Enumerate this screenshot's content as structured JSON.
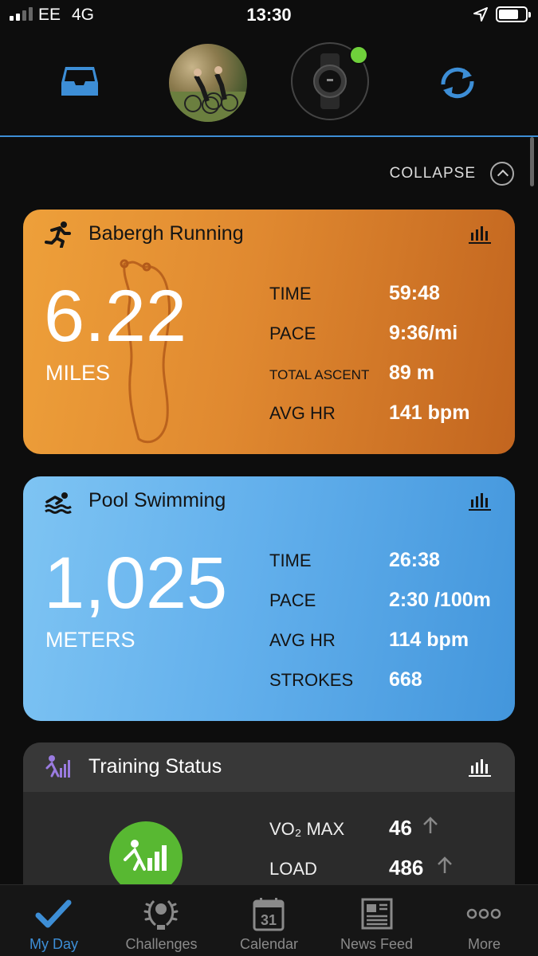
{
  "status_bar": {
    "carrier": "EE",
    "network": "4G",
    "time": "13:30"
  },
  "header": {
    "icons": [
      "inbox-icon",
      "profile-avatar",
      "device-watch",
      "sync-icon"
    ]
  },
  "collapse": {
    "label": "COLLAPSE"
  },
  "cards": {
    "running": {
      "title": "Babergh Running",
      "distance": "6.22",
      "unit": "MILES",
      "metrics": [
        {
          "label": "TIME",
          "value": "59:48"
        },
        {
          "label": "PACE",
          "value": "9:36/mi"
        },
        {
          "label": "TOTAL ASCENT",
          "value": "89 m"
        },
        {
          "label": "AVG HR",
          "value": "141 bpm"
        }
      ],
      "color": "#e08930"
    },
    "swimming": {
      "title": "Pool Swimming",
      "distance": "1,025",
      "unit": "METERS",
      "metrics": [
        {
          "label": "TIME",
          "value": "26:38"
        },
        {
          "label": "PACE",
          "value": "2:30 /100m"
        },
        {
          "label": "AVG HR",
          "value": "114 bpm"
        },
        {
          "label": "STROKES",
          "value": "668"
        }
      ],
      "color": "#63b0ec"
    },
    "training_status": {
      "title": "Training Status",
      "metrics": [
        {
          "label": "VO₂ MAX",
          "value": "46"
        },
        {
          "label": "LOAD",
          "value": "486"
        }
      ],
      "badge_color": "#58b832"
    }
  },
  "tabbar": {
    "tabs": [
      {
        "label": "My Day",
        "icon": "checkmark-icon",
        "active": true
      },
      {
        "label": "Challenges",
        "icon": "laurel-icon"
      },
      {
        "label": "Calendar",
        "icon": "calendar-icon",
        "day": "31"
      },
      {
        "label": "News Feed",
        "icon": "newspaper-icon"
      },
      {
        "label": "More",
        "icon": "more-dots-icon"
      }
    ]
  },
  "accent_color": "#3d8ed6"
}
